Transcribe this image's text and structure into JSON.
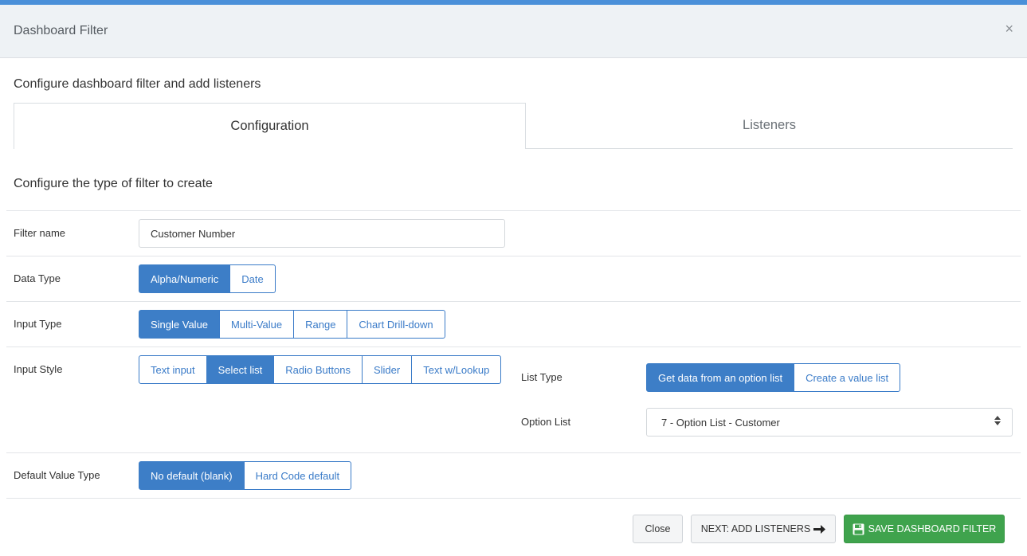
{
  "modal": {
    "title": "Dashboard Filter",
    "close_glyph": "×",
    "intro": "Configure dashboard filter and add listeners"
  },
  "tabs": [
    {
      "label": "Configuration",
      "active": true
    },
    {
      "label": "Listeners",
      "active": false
    }
  ],
  "section_title": "Configure the type of filter to create",
  "filter_name": {
    "label": "Filter name",
    "value": "Customer Number"
  },
  "data_type": {
    "label": "Data Type",
    "options": [
      "Alpha/Numeric",
      "Date"
    ],
    "selected": "Alpha/Numeric"
  },
  "input_type": {
    "label": "Input Type",
    "options": [
      "Single Value",
      "Multi-Value",
      "Range",
      "Chart Drill-down"
    ],
    "selected": "Single Value"
  },
  "input_style": {
    "label": "Input Style",
    "options": [
      "Text input",
      "Select list",
      "Radio Buttons",
      "Slider",
      "Text w/Lookup"
    ],
    "selected": "Select list"
  },
  "list_type": {
    "label": "List Type",
    "options": [
      "Get data from an option list",
      "Create a value list"
    ],
    "selected": "Get data from an option list"
  },
  "option_list": {
    "label": "Option List",
    "value": "7 - Option List - Customer"
  },
  "default_value_type": {
    "label": "Default Value Type",
    "options": [
      "No default (blank)",
      "Hard Code default"
    ],
    "selected": "No default (blank)"
  },
  "footer": {
    "close_label": "Close",
    "next_label": "NEXT: ADD LISTENERS",
    "save_label": "SAVE DASHBOARD FILTER"
  },
  "colors": {
    "accent": "#3d7ec7",
    "save": "#3fa34d",
    "header_bg": "#eef2f5",
    "topbar": "#4a90d9"
  },
  "icons": {
    "close": "close-icon",
    "next": "arrow-right-icon",
    "save": "floppy-disk-icon",
    "select": "sort-arrows-icon"
  }
}
